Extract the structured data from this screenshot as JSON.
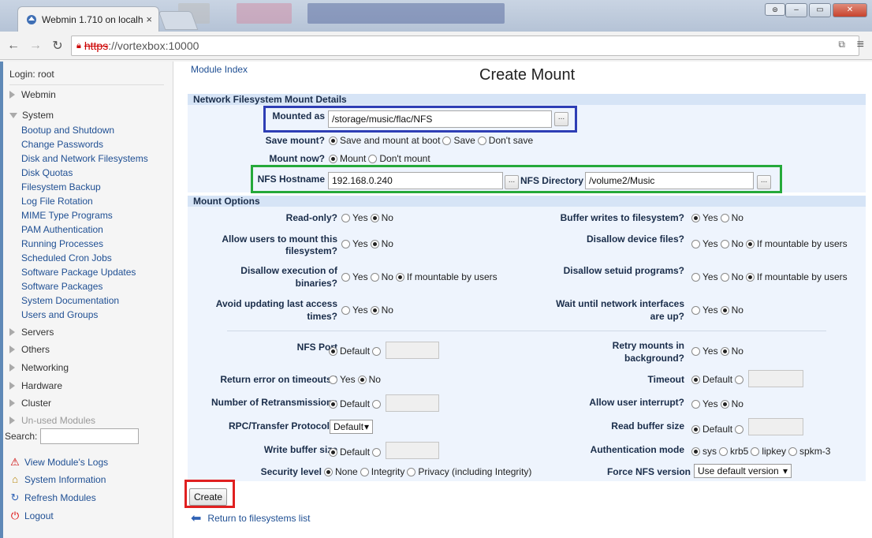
{
  "browser": {
    "tab_title": "Webmin 1.710 on localh",
    "tab_close": "×",
    "url_scheme": "https",
    "url_rest": "://vortexbox:10000"
  },
  "sidebar": {
    "login": "Login: root",
    "categories": {
      "webmin": "Webmin",
      "system": "System",
      "servers": "Servers",
      "others": "Others",
      "networking": "Networking",
      "hardware": "Hardware",
      "cluster": "Cluster",
      "unused": "Un-used Modules"
    },
    "system_modules": [
      "Bootup and Shutdown",
      "Change Passwords",
      "Disk and Network Filesystems",
      "Disk Quotas",
      "Filesystem Backup",
      "Log File Rotation",
      "MIME Type Programs",
      "PAM Authentication",
      "Running Processes",
      "Scheduled Cron Jobs",
      "Software Package Updates",
      "Software Packages",
      "System Documentation",
      "Users and Groups"
    ],
    "search_label": "Search:",
    "links": {
      "view_logs": "View Module's Logs",
      "system_info": "System Information",
      "refresh": "Refresh Modules",
      "logout": "Logout"
    }
  },
  "main": {
    "module_index": "Module Index",
    "title": "Create Mount",
    "section1": "Network Filesystem Mount Details",
    "section2": "Mount Options",
    "mounted_as_label": "Mounted as",
    "mounted_as_value": "/storage/music/flac/NFS",
    "save_mount_label": "Save mount?",
    "save_mount_opts": [
      "Save and mount at boot",
      "Save",
      "Don't save"
    ],
    "mount_now_label": "Mount now?",
    "mount_now_opts": [
      "Mount",
      "Don't mount"
    ],
    "nfs_hostname_label": "NFS Hostname",
    "nfs_hostname_value": "192.168.0.240",
    "nfs_directory_label": "NFS Directory",
    "nfs_directory_value": "/volume2/Music",
    "dots": "...",
    "yes": "Yes",
    "no": "No",
    "default": "Default",
    "if_mountable": "If mountable by users",
    "read_only": "Read-only?",
    "buffer_writes": "Buffer writes to filesystem?",
    "allow_users_1": "Allow users to mount this",
    "allow_users_2": "filesystem?",
    "disallow_device": "Disallow device files?",
    "disallow_exec_1": "Disallow execution of",
    "disallow_exec_2": "binaries?",
    "disallow_setuid": "Disallow setuid programs?",
    "avoid_updating_1": "Avoid updating last access",
    "avoid_updating_2": "times?",
    "wait_until_1": "Wait until network interfaces",
    "wait_until_2": "are up?",
    "nfs_port": "NFS Port",
    "retry_1": "Retry mounts in",
    "retry_2": "background?",
    "return_error": "Return error on timeouts?",
    "timeout": "Timeout",
    "num_retrans": "Number of Retransmissions",
    "allow_interrupt": "Allow user interrupt?",
    "rpc_protocol": "RPC/Transfer Protocol",
    "rpc_value": "Default",
    "read_buffer": "Read buffer size",
    "write_buffer": "Write buffer size",
    "auth_mode": "Authentication mode",
    "auth_opts": [
      "sys",
      "krb5",
      "lipkey",
      "spkm-3"
    ],
    "security_level": "Security level",
    "security_opts": [
      "None",
      "Integrity",
      "Privacy (including Integrity)"
    ],
    "force_nfs": "Force NFS version",
    "force_nfs_value": "Use default version",
    "create_button": "Create",
    "return_link": "Return to filesystems list"
  },
  "colors": {
    "highlight_blue": "#2e3eb5",
    "highlight_green": "#25a93a",
    "highlight_red": "#e02020",
    "link": "#1f4f93"
  }
}
